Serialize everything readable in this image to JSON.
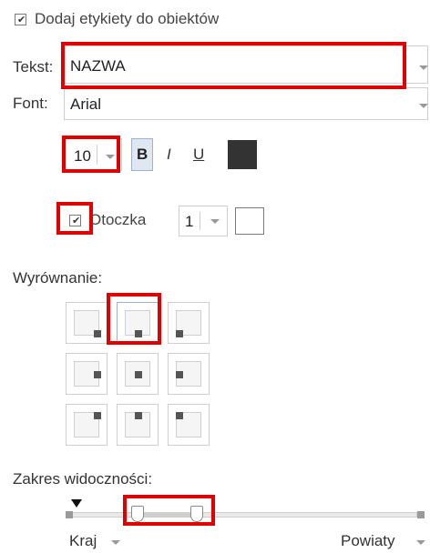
{
  "show_labels": {
    "checked": true,
    "label": "Dodaj etykiety do obiektów"
  },
  "text_field": {
    "label": "Tekst:",
    "value": "NAZWA"
  },
  "font_field": {
    "label": "Font:",
    "value": "Arial"
  },
  "font_size": {
    "value": "10"
  },
  "style_buttons": {
    "bold": "B",
    "italic": "I",
    "underline": "U",
    "bold_active": true,
    "color": "#333333"
  },
  "halo": {
    "checked": true,
    "label": "Otoczka",
    "size": "1",
    "color": "#ffffff"
  },
  "alignment": {
    "label": "Wyrównanie:",
    "options": [
      "top-left",
      "top-center",
      "top-right",
      "middle-left",
      "middle-center",
      "middle-right",
      "bottom-left",
      "bottom-center",
      "bottom-right"
    ],
    "selected": "top-center"
  },
  "visibility_range": {
    "label": "Zakres widoczności:",
    "min_label": "Kraj",
    "max_label": "Powiaty"
  },
  "annotation_color": "#e00000"
}
